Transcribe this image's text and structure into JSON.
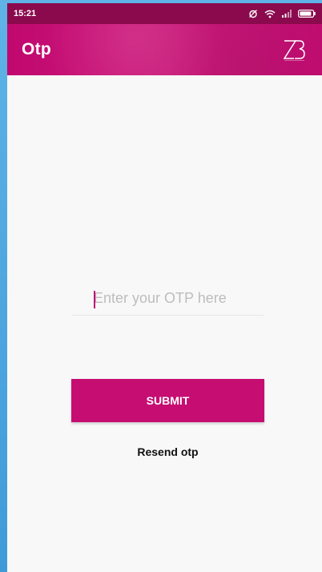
{
  "status_bar": {
    "time": "15:21",
    "icons": [
      "alarm-icon",
      "wifi-icon",
      "signal-icon",
      "battery-icon"
    ]
  },
  "app_bar": {
    "title": "Otp",
    "logo_text": "ZB"
  },
  "otp_form": {
    "input_value": "",
    "input_placeholder": "Enter your OTP here",
    "submit_label": "SUBMIT",
    "resend_label": "Resend otp"
  },
  "colors": {
    "primary": "#c60d72",
    "status_bar": "#8a0a4d",
    "background": "#f8f8f8",
    "frame": "#4fa6de"
  }
}
